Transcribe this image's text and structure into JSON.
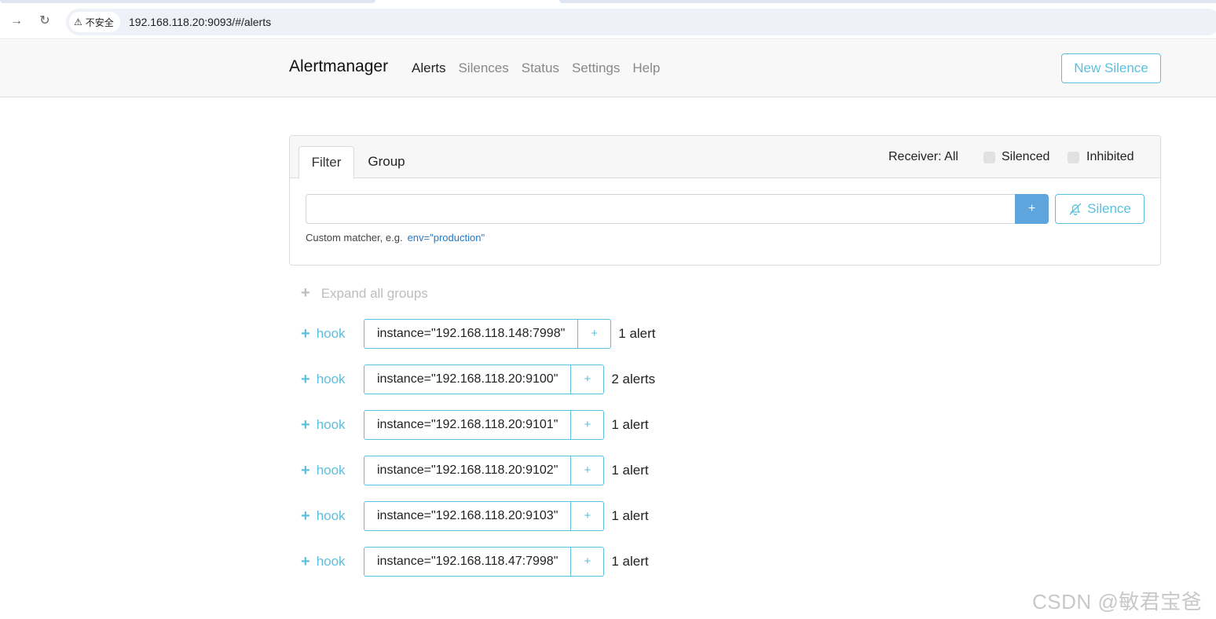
{
  "browser": {
    "security_label": "不安全",
    "url": "192.168.118.20:9093/#/alerts"
  },
  "navbar": {
    "brand": "Alertmanager",
    "links": [
      "Alerts",
      "Silences",
      "Status",
      "Settings",
      "Help"
    ],
    "active": "Alerts",
    "new_silence": "New Silence"
  },
  "filter": {
    "tabs": [
      "Filter",
      "Group"
    ],
    "receiver": "Receiver: All",
    "silenced_label": "Silenced",
    "inhibited_label": "Inhibited",
    "input_value": "",
    "plus": "+",
    "silence_button": "Silence",
    "hint_prefix": "Custom matcher, e.g.",
    "hint_example": "env=\"production\""
  },
  "expand_all": "Expand all groups",
  "groups": [
    {
      "receiver": "hook",
      "label": "instance=\"192.168.118.148:7998\"",
      "count": "1 alert"
    },
    {
      "receiver": "hook",
      "label": "instance=\"192.168.118.20:9100\"",
      "count": "2 alerts"
    },
    {
      "receiver": "hook",
      "label": "instance=\"192.168.118.20:9101\"",
      "count": "1 alert"
    },
    {
      "receiver": "hook",
      "label": "instance=\"192.168.118.20:9102\"",
      "count": "1 alert"
    },
    {
      "receiver": "hook",
      "label": "instance=\"192.168.118.20:9103\"",
      "count": "1 alert"
    },
    {
      "receiver": "hook",
      "label": "instance=\"192.168.118.47:7998\"",
      "count": "1 alert"
    }
  ],
  "add_symbol": "+",
  "watermark": "CSDN @敏君宝爸",
  "colors": {
    "accent": "#5bc0de",
    "primary": "#5da5dc",
    "link": "#2577c6"
  }
}
